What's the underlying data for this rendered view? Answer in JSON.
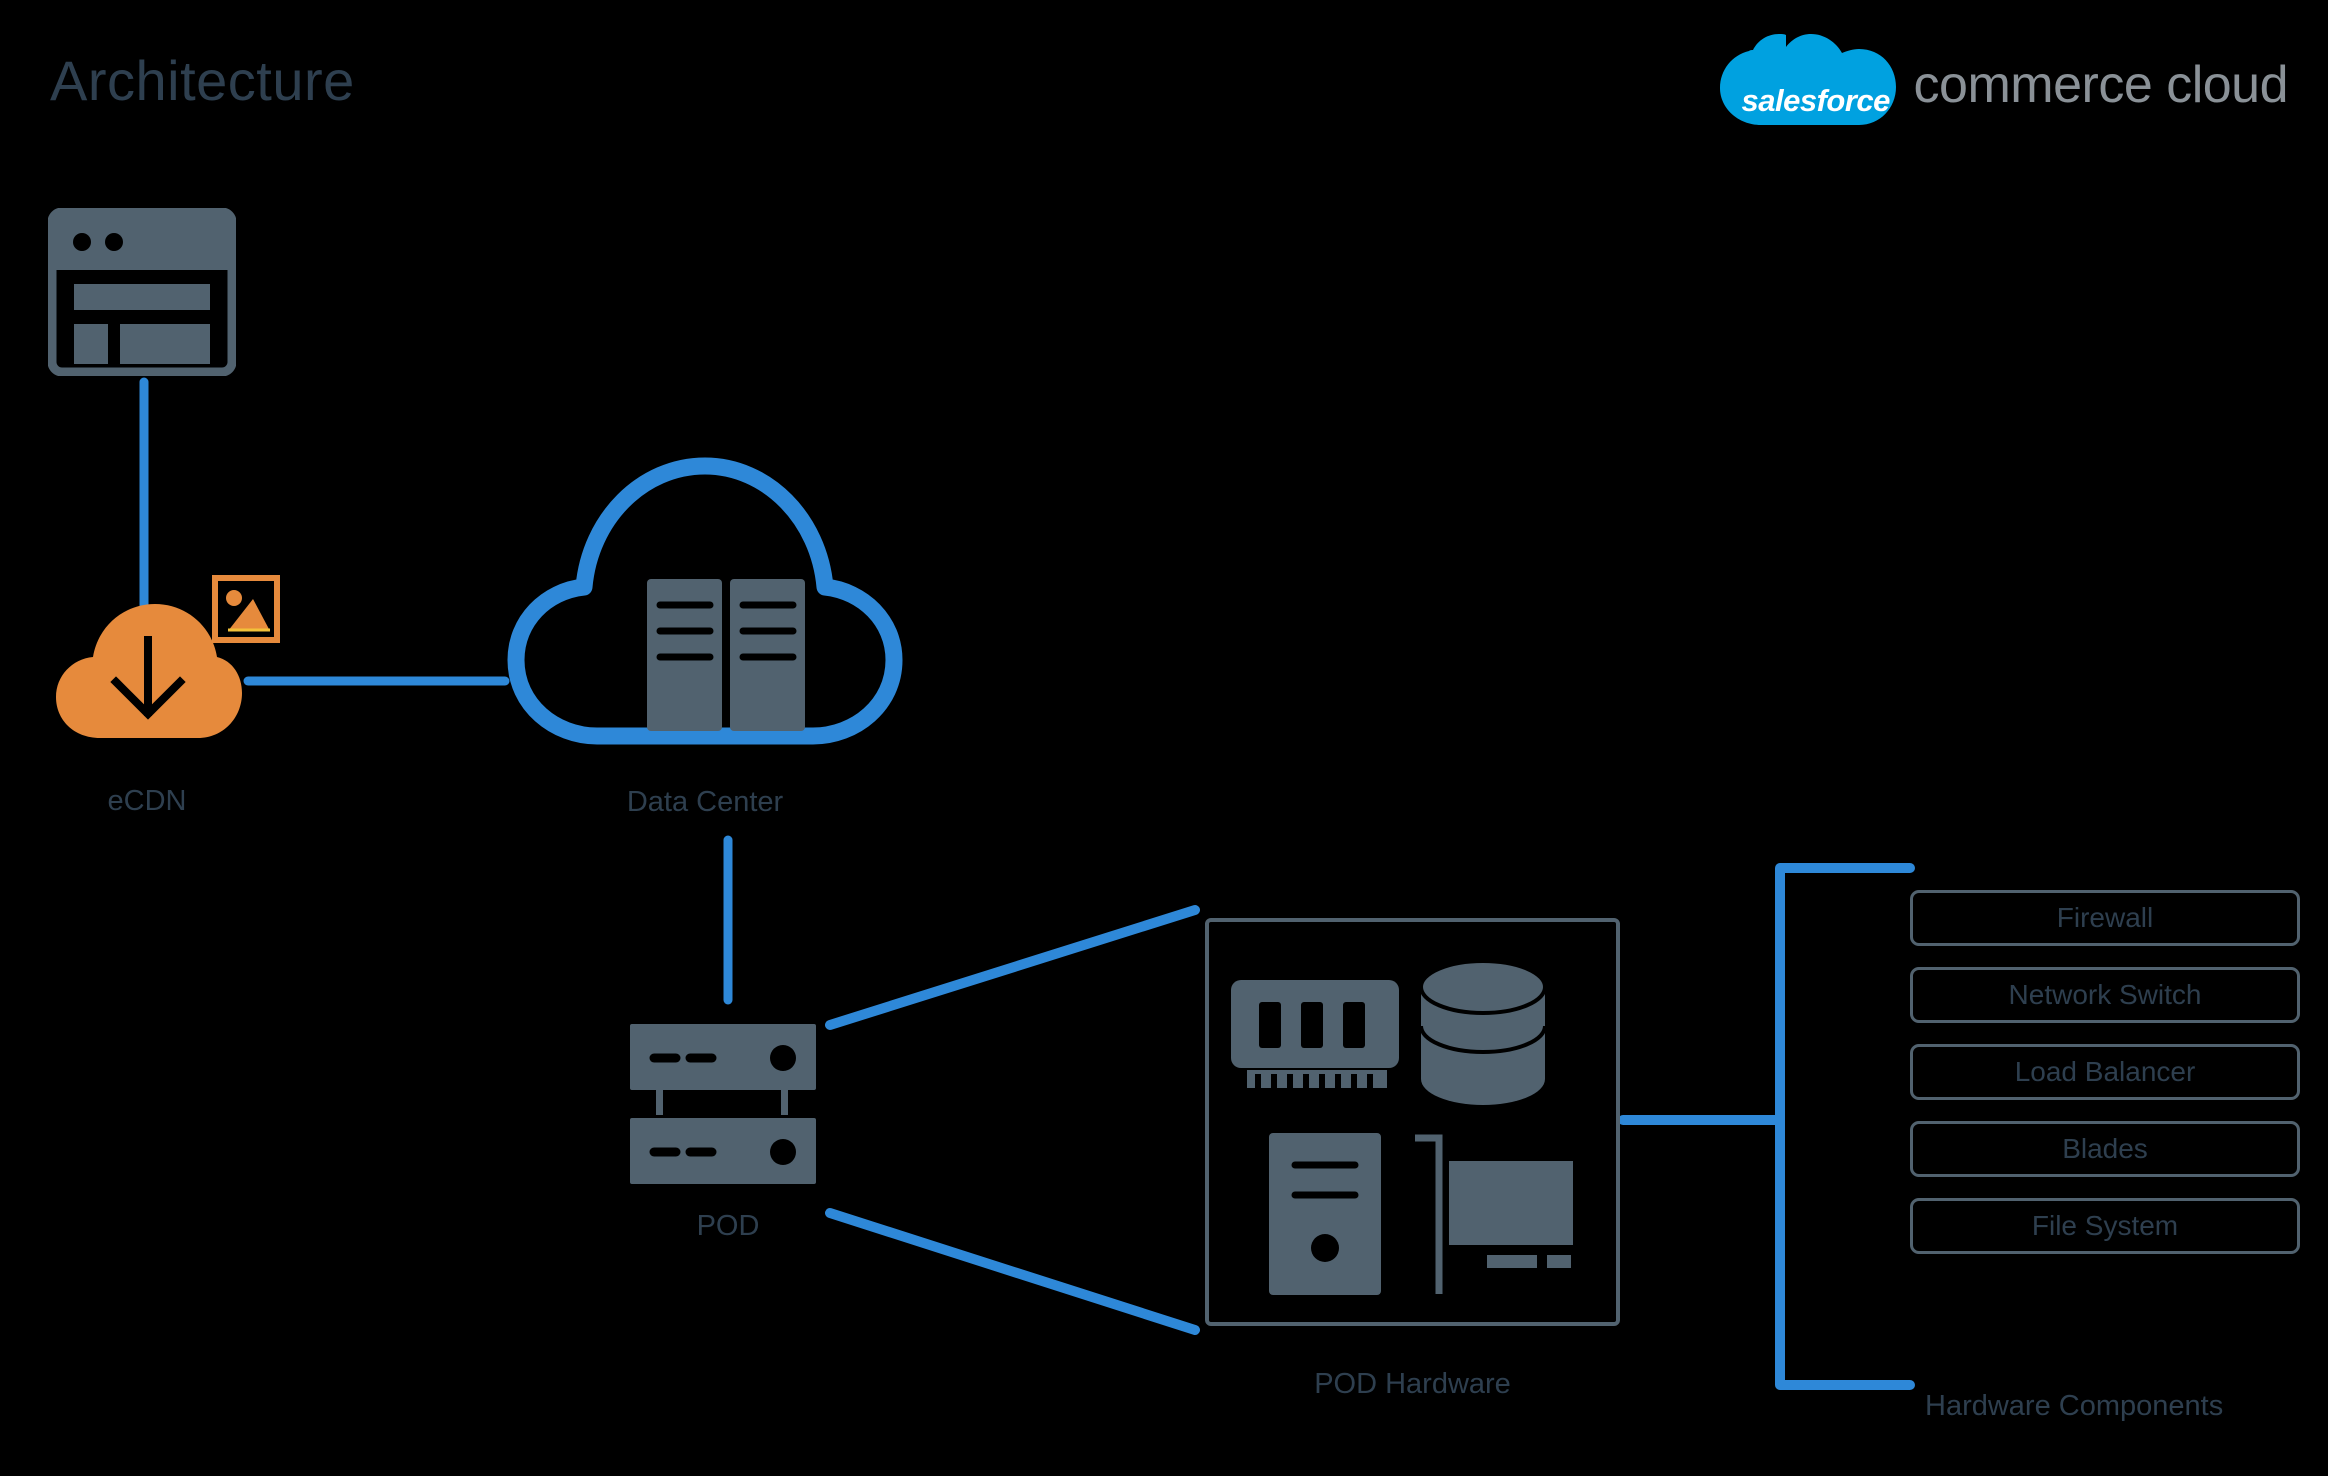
{
  "page": {
    "title": "Architecture",
    "background_color": "#000000",
    "accent_blue": "#2E88D8",
    "slate": "#51626F",
    "dark_slate": "#2E3F4F",
    "orange": "#E68A3C",
    "salesforce_blue": "#00A1E0"
  },
  "logo": {
    "brand": "salesforce",
    "product": "commerce cloud",
    "cloud_color": "#00A1E0",
    "product_color": "#8A9197"
  },
  "nodes": {
    "browser": {
      "label": "",
      "icon": "browser-window-icon"
    },
    "ecdn": {
      "label": "eCDN",
      "icon": "cloud-download-icon",
      "badge_icon": "image-asset-icon",
      "color": "#E68A3C"
    },
    "data_center": {
      "label": "Data Center",
      "icon": "cloud-servers-icon",
      "color": "#2E88D8"
    },
    "pod": {
      "label": "POD",
      "icon": "rack-servers-icon",
      "color": "#51626F"
    },
    "pod_hardware": {
      "label": "POD Hardware",
      "icons": [
        "memory-module-icon",
        "database-cylinder-icon",
        "pc-tower-icon",
        "monitor-icon"
      ]
    }
  },
  "hardware_components": {
    "caption": "Hardware Components",
    "items": [
      {
        "label": "Firewall"
      },
      {
        "label": "Network Switch"
      },
      {
        "label": "Load Balancer"
      },
      {
        "label": "Blades"
      },
      {
        "label": "File System"
      }
    ]
  }
}
